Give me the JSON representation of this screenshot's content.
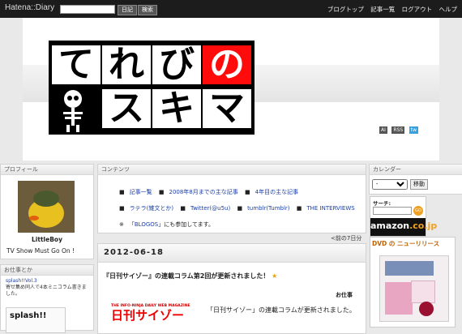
{
  "topbar": {
    "logo": "Hatena::Diary",
    "search_button": "日記",
    "search_button2": "検索",
    "nav": [
      "ブログトップ",
      "記事一覧",
      "ログアウト",
      "ヘルプ"
    ]
  },
  "header": {
    "logo_row1": [
      "て",
      "れ",
      "び",
      "の"
    ],
    "logo_row2": [
      "ス",
      "キ",
      "マ"
    ],
    "feed_icons": [
      "AI",
      "RSS",
      "tw"
    ]
  },
  "profile": {
    "heading": "プロフィール",
    "name": "LittleBoy",
    "desc": "TV Show Must Go On !"
  },
  "otoku": {
    "heading": "お仕事とか",
    "link": "splash!!Vol.3",
    "text": "寄せ集め同人で4本ミニコラム書きました。",
    "thumb_text": "splash!!"
  },
  "contents": {
    "heading": "コンテンツ",
    "links": [
      "記事一覧",
      "2008年8月までの主な記事",
      "4年目の主な記事",
      "ラテラ(雑文とか)",
      "Twitter(@u5u)",
      "tumblr(Tumblr)",
      "THE INTERVIEWS"
    ],
    "note_prefix": "※",
    "note_link": "「BLOGOS」",
    "note_suffix": "にも参加してます。"
  },
  "nav_prev": "<前の7日分",
  "entry": {
    "date": "2012-06-18",
    "title": "『日刊サイゾー』の連載コラム第2回が更新されました！",
    "category": "お仕事",
    "zine_small": "THE INFO-NINJA DAILY WEB MAGAZINE",
    "zine_big": "日刊サイゾー",
    "body": "「日刊サイゾー」の連載コラムが更新されました。"
  },
  "calendar": {
    "heading": "カレンダー",
    "select_value": "-",
    "go": "移動"
  },
  "amazon": {
    "label": "サーチ:",
    "go": "GO",
    "logo": "amazon",
    "logo_jp": ".co.jp"
  },
  "news": {
    "heading": "DVD の ニューリリース"
  }
}
